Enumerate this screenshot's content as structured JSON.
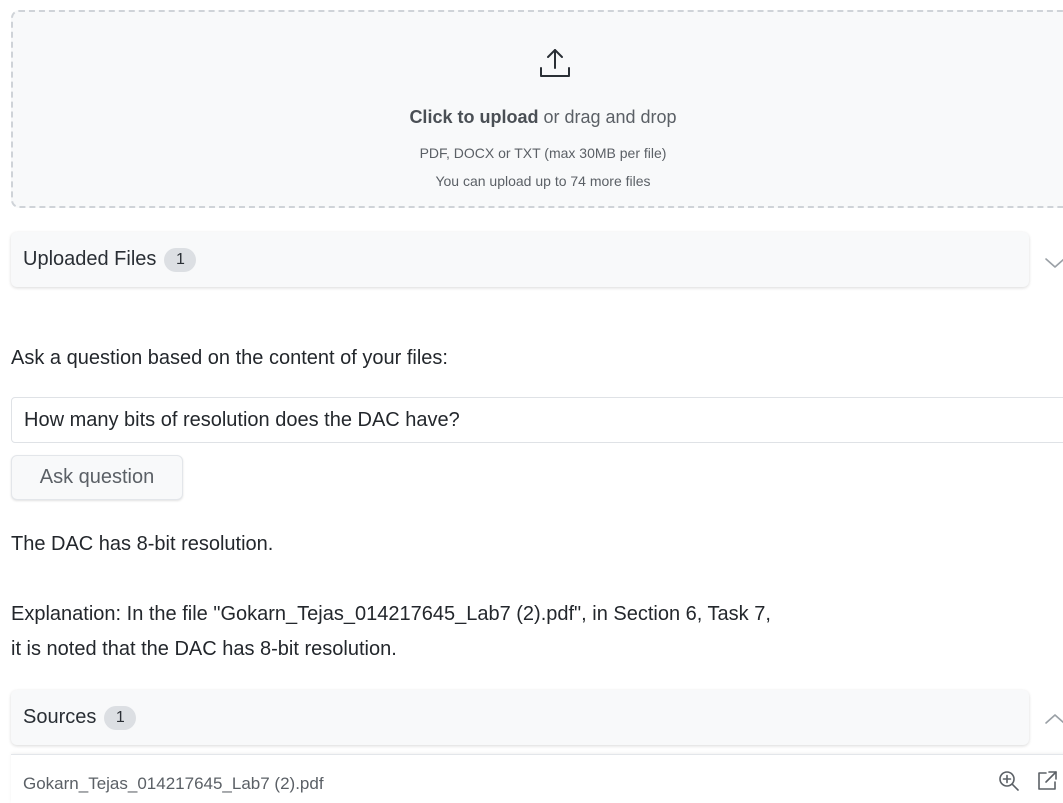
{
  "upload": {
    "click_text": "Click to upload",
    "rest_text": " or drag and drop",
    "formats": "PDF, DOCX or TXT (max 30MB per file)",
    "remaining": "You can upload up to 74 more files",
    "icon": "upload-icon"
  },
  "uploaded_files": {
    "title": "Uploaded Files",
    "count": "1",
    "expanded": false
  },
  "question": {
    "label": "Ask a question based on the content of your files:",
    "value": "How many bits of resolution does the DAC have?",
    "button_label": "Ask question"
  },
  "answer": {
    "text": "The DAC has 8-bit resolution.",
    "explanation": "Explanation: In the file \"Gokarn_Tejas_014217645_Lab7 (2).pdf\", in Section 6, Task 7, it is noted that the DAC has 8-bit resolution."
  },
  "sources": {
    "title": "Sources",
    "count": "1",
    "expanded": true,
    "items": [
      {
        "name": "Gokarn_Tejas_014217645_Lab7 (2).pdf",
        "icons": [
          "zoom-in-icon",
          "external-link-icon"
        ]
      }
    ]
  }
}
